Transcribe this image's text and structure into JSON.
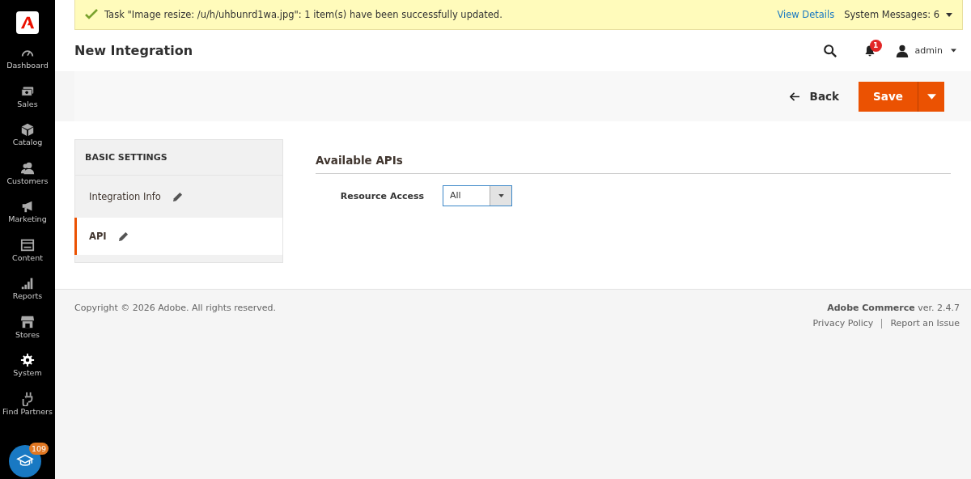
{
  "sidebar": {
    "items": [
      {
        "label": "Dashboard",
        "kind": "dashboard"
      },
      {
        "label": "Sales",
        "kind": "sales"
      },
      {
        "label": "Catalog",
        "kind": "catalog"
      },
      {
        "label": "Customers",
        "kind": "customers"
      },
      {
        "label": "Marketing",
        "kind": "marketing"
      },
      {
        "label": "Content",
        "kind": "content"
      },
      {
        "label": "Reports",
        "kind": "reports"
      },
      {
        "label": "Stores",
        "kind": "stores"
      },
      {
        "label": "System",
        "kind": "system"
      },
      {
        "label": "Find Partners",
        "kind": "partners"
      }
    ]
  },
  "help": {
    "badge": "109"
  },
  "notification": {
    "message": "Task \"Image resize: /u/h/uhbunrd1wa.jpg\": 1 item(s) have been successfully updated.",
    "link": "View Details",
    "system_messages": "System Messages: 6"
  },
  "header": {
    "title": "New Integration",
    "notifications_count": "1",
    "user": "admin"
  },
  "actions": {
    "back": "Back",
    "save": "Save"
  },
  "tabs": {
    "heading": "BASIC SETTINGS",
    "items": [
      {
        "label": "Integration Info",
        "selected": false
      },
      {
        "label": "API",
        "selected": true
      }
    ]
  },
  "section": {
    "title": "Available APIs",
    "fields": [
      {
        "label": "Resource Access",
        "value": "All"
      }
    ]
  },
  "footer": {
    "copyright": "Copyright © 2026 Adobe. All rights reserved.",
    "product": "Adobe Commerce",
    "version": "ver. 2.4.7",
    "links": [
      "Privacy Policy",
      "Report an Issue"
    ]
  }
}
